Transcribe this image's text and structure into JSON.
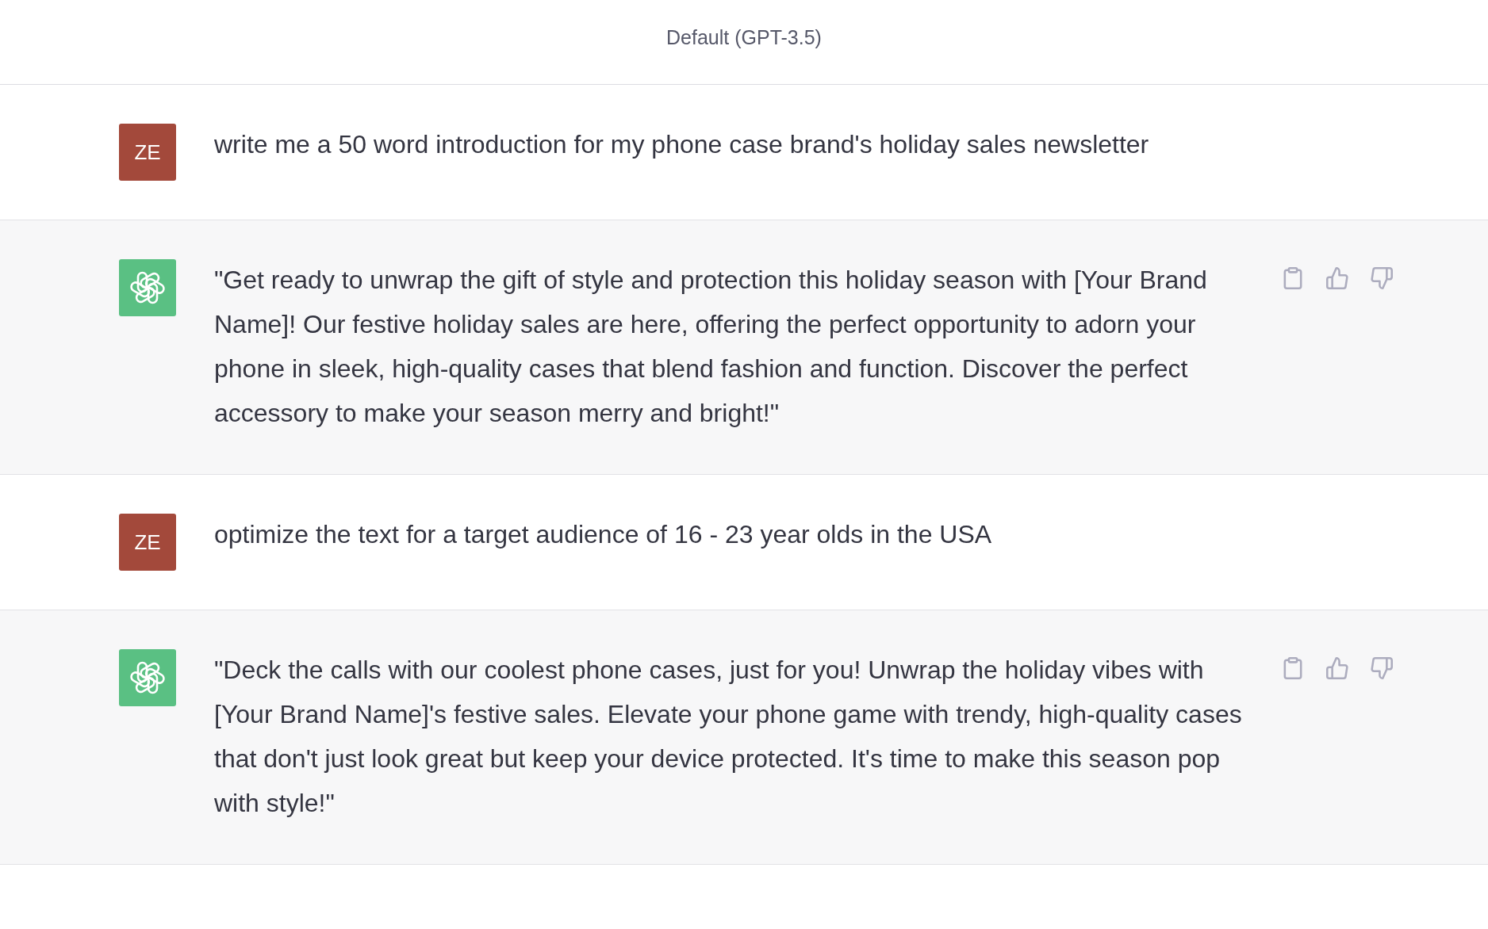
{
  "header": {
    "title": "Default (GPT-3.5)"
  },
  "messages": [
    {
      "kind": "user",
      "avatar": "ZE",
      "text": "write me a 50 word introduction for my phone case brand's holiday sales newsletter"
    },
    {
      "kind": "assistant",
      "text": "\"Get ready to unwrap the gift of style and protection this holiday season with [Your Brand Name]! Our festive holiday sales are here, offering the perfect opportunity to adorn your phone in sleek, high-quality cases that blend fashion and function. Discover the perfect accessory to make your season merry and bright!\""
    },
    {
      "kind": "user",
      "avatar": "ZE",
      "text": "optimize the text for a target audience of 16 - 23 year olds in the USA"
    },
    {
      "kind": "assistant",
      "text": "\"Deck the calls with our coolest phone cases, just for you! Unwrap the holiday vibes with [Your Brand Name]'s festive sales. Elevate your phone game with trendy, high-quality cases that don't just look great but keep your device protected. It's time to make this season pop with style!\""
    }
  ]
}
